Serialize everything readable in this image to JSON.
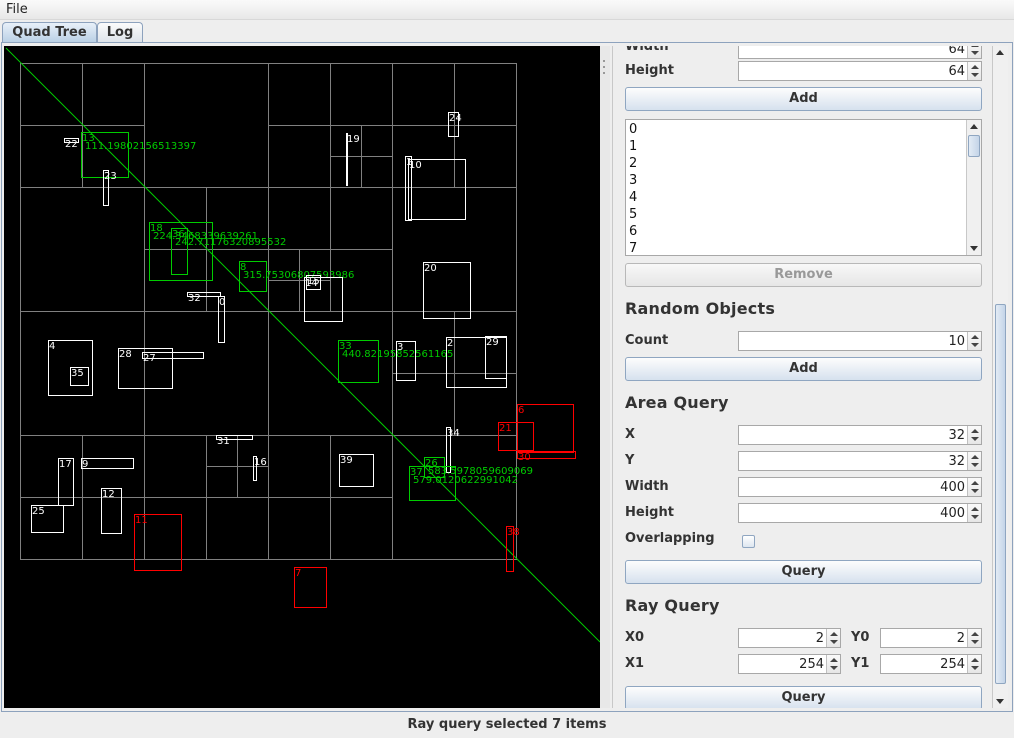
{
  "menu": {
    "file": "File"
  },
  "tabs": [
    {
      "label": "Quad Tree"
    },
    {
      "label": "Log"
    }
  ],
  "colors": {
    "canvas_bg": "#000000",
    "grid": "#808080",
    "object": "#ffffff",
    "hit": "#00cc00",
    "outside": "#ff0000",
    "ray": "#00cc00"
  },
  "canvas": {
    "objects": [
      {
        "id": "22",
        "kind": "white"
      },
      {
        "id": "13",
        "kind": "green",
        "distance": "111.19802156513397"
      },
      {
        "id": "23",
        "kind": "white"
      },
      {
        "id": "19",
        "kind": "white"
      },
      {
        "id": "24",
        "kind": "white"
      },
      {
        "id": "1",
        "kind": "white"
      },
      {
        "id": "10",
        "kind": "white"
      },
      {
        "id": "18",
        "kind": "green",
        "distance": "224.3468339639261"
      },
      {
        "id": "36",
        "kind": "green",
        "distance": "242.71176320895532"
      },
      {
        "id": "8",
        "kind": "green",
        "distance": "315.75306807593986"
      },
      {
        "id": "32",
        "kind": "white"
      },
      {
        "id": "0",
        "kind": "white"
      },
      {
        "id": "15",
        "kind": "white"
      },
      {
        "id": "14",
        "kind": "white"
      },
      {
        "id": "20",
        "kind": "white"
      },
      {
        "id": "33",
        "kind": "green",
        "distance": "440.82195852561165"
      },
      {
        "id": "4",
        "kind": "white"
      },
      {
        "id": "35",
        "kind": "white"
      },
      {
        "id": "28",
        "kind": "white"
      },
      {
        "id": "27",
        "kind": "white"
      },
      {
        "id": "3",
        "kind": "white"
      },
      {
        "id": "2",
        "kind": "white"
      },
      {
        "id": "29",
        "kind": "white"
      },
      {
        "id": "6",
        "kind": "red"
      },
      {
        "id": "21",
        "kind": "red"
      },
      {
        "id": "30",
        "kind": "red"
      },
      {
        "id": "34",
        "kind": "white"
      },
      {
        "id": "31",
        "kind": "white"
      },
      {
        "id": "16",
        "kind": "white"
      },
      {
        "id": "39",
        "kind": "white"
      },
      {
        "id": "26",
        "kind": "green",
        "distance": "583.5978059609069"
      },
      {
        "id": "37",
        "kind": "green",
        "distance": "579.0120622991042"
      },
      {
        "id": "17",
        "kind": "white"
      },
      {
        "id": "9",
        "kind": "white"
      },
      {
        "id": "12",
        "kind": "white"
      },
      {
        "id": "25",
        "kind": "white"
      },
      {
        "id": "11",
        "kind": "red"
      },
      {
        "id": "38",
        "kind": "red"
      },
      {
        "id": "7",
        "kind": "red"
      }
    ]
  },
  "panel": {
    "width_label": "Width",
    "width_value": "64",
    "height_label": "Height",
    "height_value": "64",
    "add_button": "Add",
    "list_items": [
      "0",
      "1",
      "2",
      "3",
      "4",
      "5",
      "6",
      "7"
    ],
    "remove_button": "Remove",
    "random": {
      "title": "Random Objects",
      "count_label": "Count",
      "count_value": "10",
      "add_button": "Add"
    },
    "area": {
      "title": "Area Query",
      "x_label": "X",
      "x_value": "32",
      "y_label": "Y",
      "y_value": "32",
      "width_label": "Width",
      "width_value": "400",
      "height_label": "Height",
      "height_value": "400",
      "overlap_label": "Overlapping",
      "overlap_checked": false,
      "query_button": "Query"
    },
    "ray": {
      "title": "Ray Query",
      "x0_label": "X0",
      "x0_value": "2",
      "y0_label": "Y0",
      "y0_value": "2",
      "x1_label": "X1",
      "x1_value": "254",
      "y1_label": "Y1",
      "y1_value": "254",
      "query_button": "Query"
    }
  },
  "status": "Ray query selected 7 items"
}
